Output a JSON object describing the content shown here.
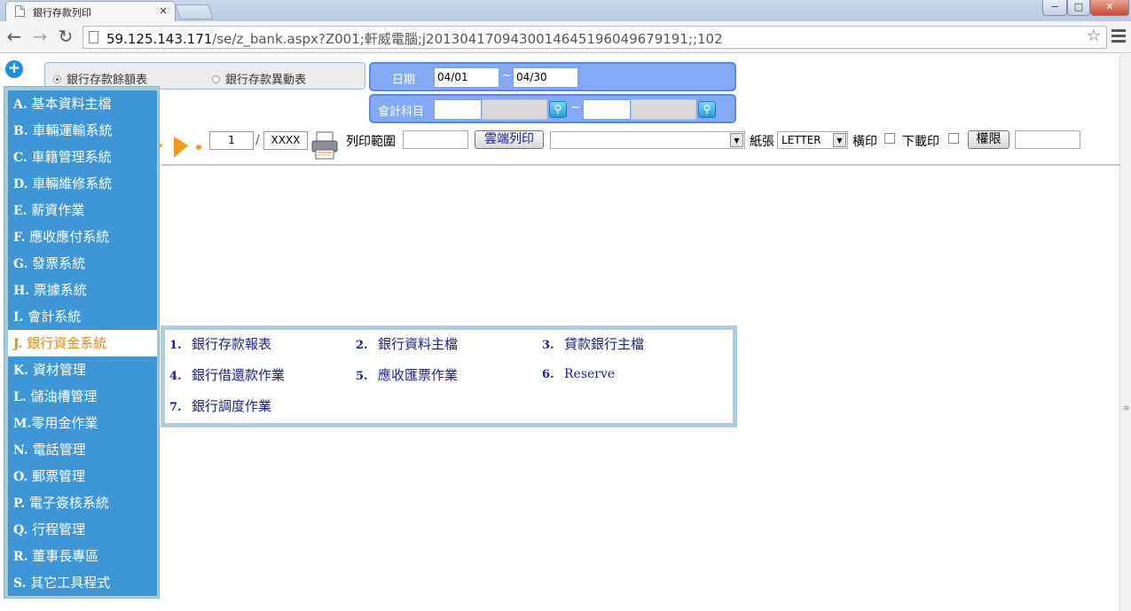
{
  "browser": {
    "tab_title": "銀行存款列印",
    "tab_close": "×",
    "url_host": "59.125.143.171",
    "url_path": "/se/z_bank.aspx?Z001;軒威電腦;j20130417094300146451960496791​91;;102",
    "minimize": "−",
    "maximize": "□",
    "close": "✕"
  },
  "report_type": {
    "options": [
      {
        "label": "銀行存款餘額表",
        "selected": true
      },
      {
        "label": "銀行存款異動表",
        "selected": false
      }
    ]
  },
  "filters": {
    "date_label": "日期",
    "date_from": "04/01",
    "date_to": "04/30",
    "tilde": "~",
    "account_label": "會計科目",
    "account_from": "",
    "account_to": ""
  },
  "pager": {
    "page": "1",
    "separator": "/",
    "total": "XXXX",
    "print_range_label": "列印範圍",
    "print_range_value": "",
    "cloud_print_button": "雲端列印",
    "printer_select": "",
    "paper_label": "紙張",
    "paper_value": "LETTER",
    "landscape_label": "橫印",
    "download_label": "下載印",
    "permission_button": "權限",
    "extra_field": ""
  },
  "left_menu": [
    {
      "key": "A.",
      "label": "基本資料主檔",
      "active": false
    },
    {
      "key": "B.",
      "label": "車輛運輸系統",
      "active": false
    },
    {
      "key": "C.",
      "label": "車籍管理系統",
      "active": false
    },
    {
      "key": "D.",
      "label": "車輛維修系統",
      "active": false
    },
    {
      "key": "E.",
      "label": "薪資作業",
      "active": false
    },
    {
      "key": "F.",
      "label": "應收應付系統",
      "active": false
    },
    {
      "key": "G.",
      "label": "發票系統",
      "active": false
    },
    {
      "key": "H.",
      "label": "票據系統",
      "active": false
    },
    {
      "key": "I.",
      "label": "會計系統",
      "active": false
    },
    {
      "key": "J.",
      "label": "銀行資金系統",
      "active": true
    },
    {
      "key": "K.",
      "label": "資材管理",
      "active": false
    },
    {
      "key": "L.",
      "label": "儲油槽管理",
      "active": false
    },
    {
      "key": "M.",
      "label": "零用金作業",
      "active": false
    },
    {
      "key": "N.",
      "label": "電話管理",
      "active": false
    },
    {
      "key": "O.",
      "label": "郵票管理",
      "active": false
    },
    {
      "key": "P.",
      "label": "電子簽核系統",
      "active": false
    },
    {
      "key": "Q.",
      "label": "行程管理",
      "active": false
    },
    {
      "key": "R.",
      "label": "董事長專區",
      "active": false
    },
    {
      "key": "S.",
      "label": "其它工具程式",
      "active": false
    }
  ],
  "sub_menu": [
    {
      "num": "1.",
      "label": "銀行存款報表"
    },
    {
      "num": "2.",
      "label": "銀行資料主檔"
    },
    {
      "num": "3.",
      "label": "貸款銀行主檔"
    },
    {
      "num": "4.",
      "label": "銀行借還款作業"
    },
    {
      "num": "5.",
      "label": "應收匯票作業"
    },
    {
      "num": "6.",
      "label": "Reserve"
    },
    {
      "num": "7.",
      "label": "銀行調度作業"
    }
  ],
  "colors": {
    "menu_blue": "#3f96d7",
    "active_orange": "#e48a16",
    "filter_blue": "#84a9f5",
    "submenu_text": "#1a1f99"
  }
}
